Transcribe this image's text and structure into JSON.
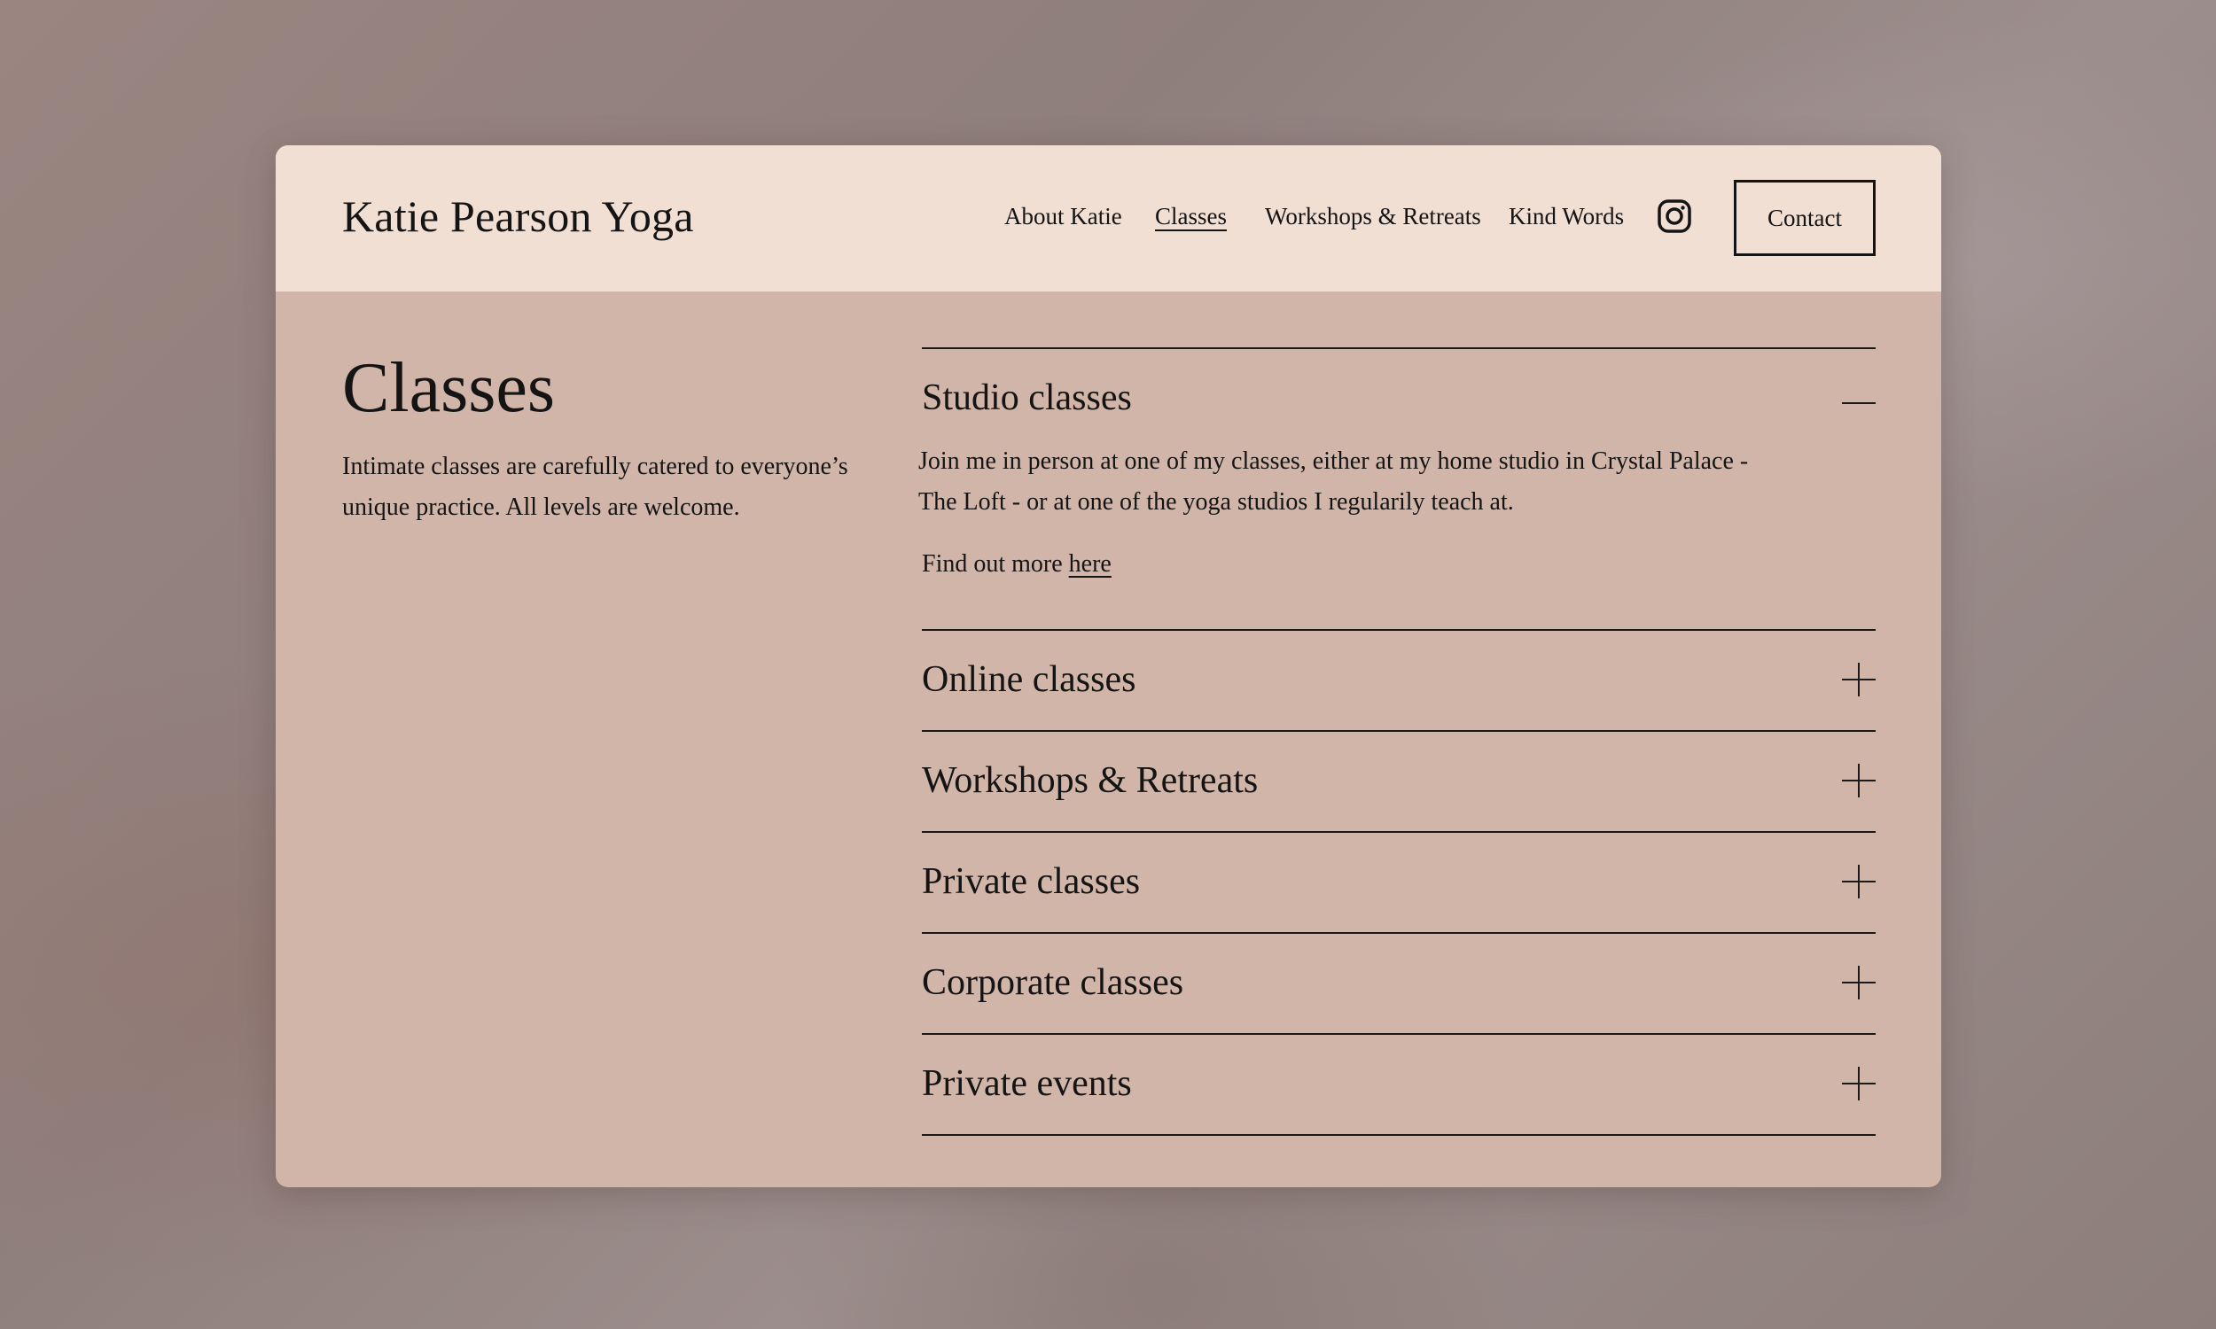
{
  "header": {
    "logo": "Katie Pearson Yoga",
    "nav": [
      {
        "label": "About Katie"
      },
      {
        "label": "Classes",
        "active": true
      },
      {
        "label": "Workshops & Retreats"
      },
      {
        "label": "Kind Words"
      }
    ],
    "instagram_icon": "instagram-icon",
    "contact_label": "Contact"
  },
  "main": {
    "title": "Classes",
    "intro": "Intimate classes are carefully catered to everyone’s unique practice. All levels are welcome."
  },
  "accordion": {
    "items": [
      {
        "title": "Studio classes",
        "expanded": true,
        "description": "Join me in person at one of my classes, either at my home studio in Crystal Palace - The Loft - or at one of the yoga studios I regularily teach at.",
        "more_prefix": "Find out more ",
        "more_link": "here"
      },
      {
        "title": "Online classes",
        "expanded": false
      },
      {
        "title": "Workshops & Retreats",
        "expanded": false
      },
      {
        "title": "Private classes",
        "expanded": false
      },
      {
        "title": "Corporate classes",
        "expanded": false
      },
      {
        "title": "Private events",
        "expanded": false
      }
    ]
  },
  "colors": {
    "header_bg": "#f2dfd4",
    "content_bg": "#d1b5a8",
    "text": "#141414"
  }
}
